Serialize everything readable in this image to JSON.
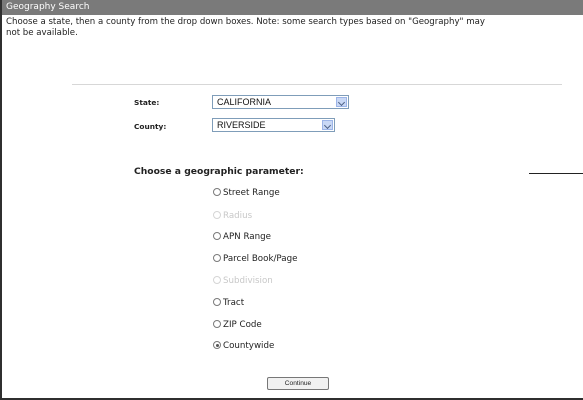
{
  "window": {
    "title": "Geography Search"
  },
  "intro": {
    "line1": "Choose a state, then a county from the drop down boxes. Note: some search types based on \"Geography\" may",
    "line2": "not be available."
  },
  "form": {
    "state_label": "State:",
    "state_value": "CALIFORNIA",
    "county_label": "County:",
    "county_value": "RIVERSIDE"
  },
  "params": {
    "heading": "Choose a geographic parameter:",
    "options": [
      {
        "label": "Street Range",
        "enabled": true,
        "selected": false
      },
      {
        "label": "Radius",
        "enabled": false,
        "selected": false
      },
      {
        "label": "APN Range",
        "enabled": true,
        "selected": false
      },
      {
        "label": "Parcel Book/Page",
        "enabled": true,
        "selected": false
      },
      {
        "label": "Subdivision",
        "enabled": false,
        "selected": false
      },
      {
        "label": "Tract",
        "enabled": true,
        "selected": false
      },
      {
        "label": "ZIP Code",
        "enabled": true,
        "selected": false
      },
      {
        "label": "Countywide",
        "enabled": true,
        "selected": true
      }
    ]
  },
  "actions": {
    "continue_label": "Continue"
  }
}
